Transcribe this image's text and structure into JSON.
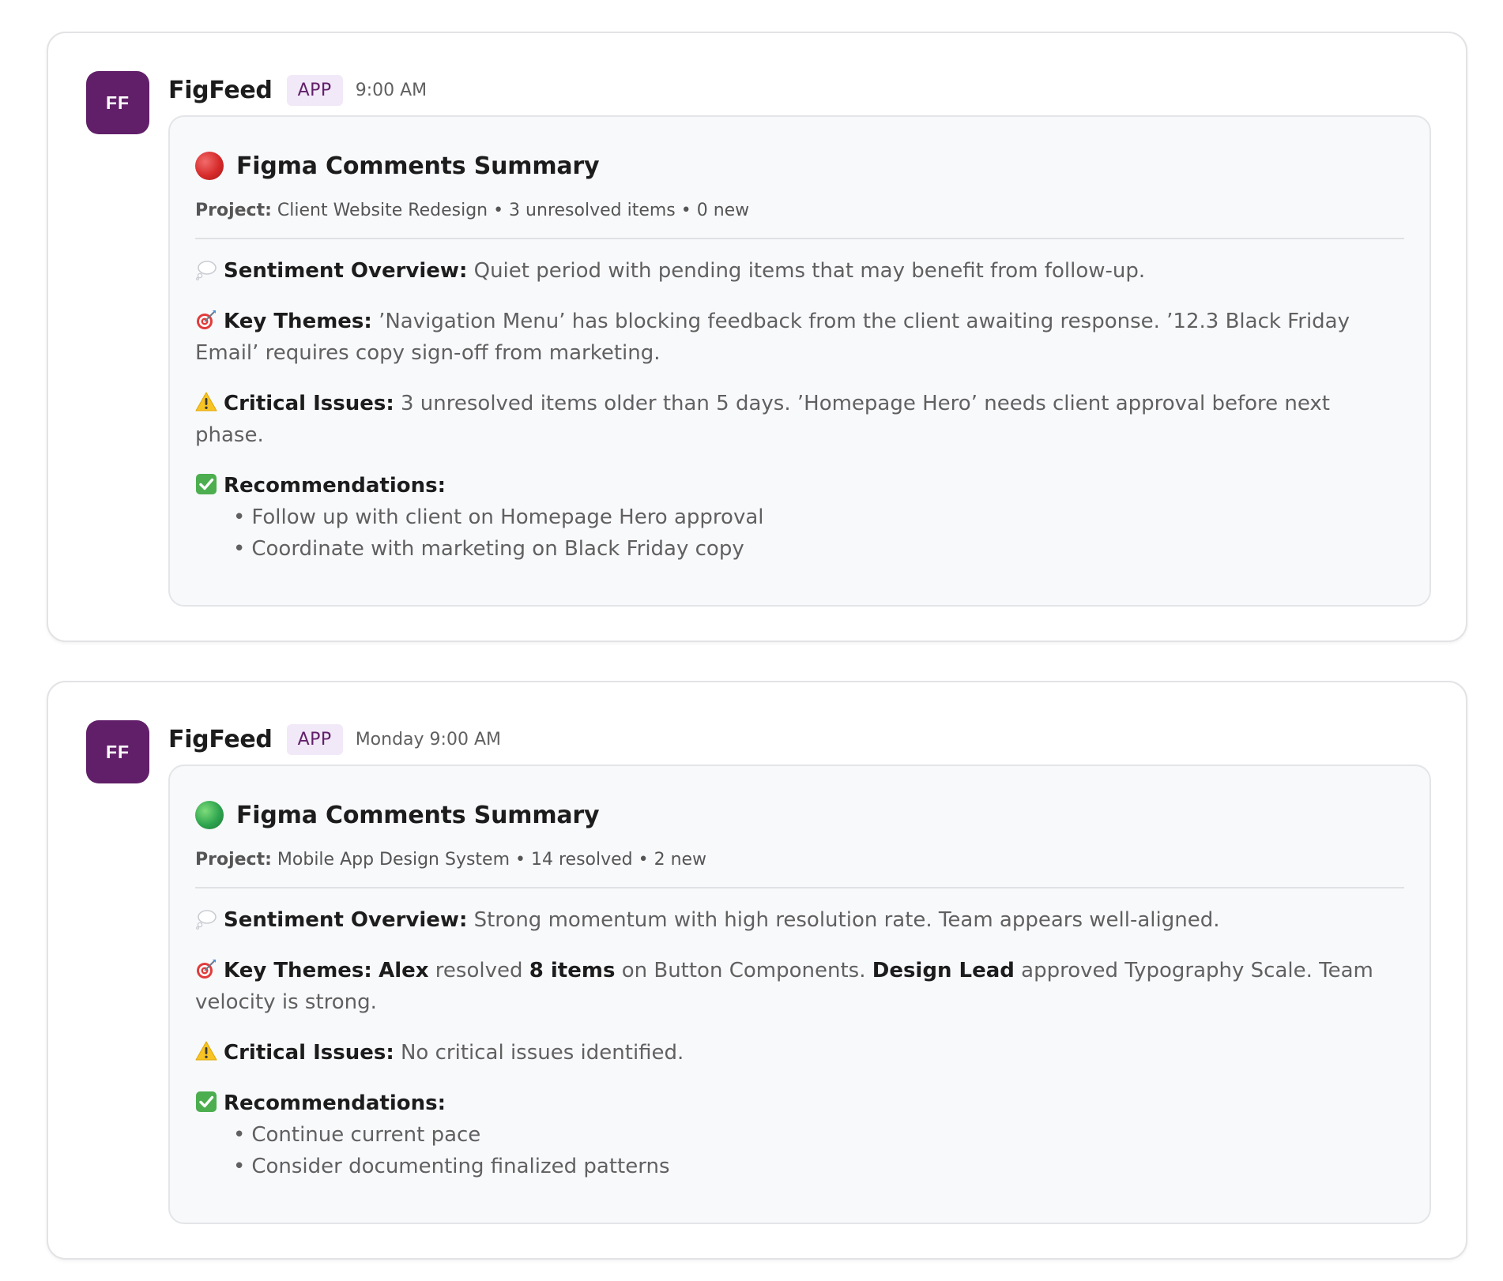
{
  "messages": [
    {
      "avatar_initials": "FF",
      "sender": "FigFeed",
      "badge": "APP",
      "timestamp": "9:00 AM",
      "card": {
        "status_color": "#d62a2a",
        "title": "Figma Comments Summary",
        "meta_label": "Project:",
        "meta_text": "Client Website Redesign • 3 unresolved items • 0 new",
        "sentiment_label": "Sentiment Overview:",
        "sentiment_text": "Quiet period with pending items that may benefit from follow-up.",
        "themes_label": "Key Themes:",
        "themes_text": "’Navigation Menu’ has blocking feedback from the client awaiting response. ’12.3 Black Friday Email’ requires copy sign-off from marketing.",
        "issues_label": "Critical Issues:",
        "issues_text": "3 unresolved items older than 5 days. ’Homepage Hero’ needs client approval before next phase.",
        "recommendations_label": "Recommendations:",
        "recommendations": [
          "Follow up with client on Homepage Hero approval",
          "Coordinate with marketing on Black Friday copy"
        ]
      }
    },
    {
      "avatar_initials": "FF",
      "sender": "FigFeed",
      "badge": "APP",
      "timestamp": "Monday 9:00 AM",
      "card": {
        "status_color": "#2ea44f",
        "title": "Figma Comments Summary",
        "meta_label": "Project:",
        "meta_text": "Mobile App Design System • 14 resolved • 2 new",
        "sentiment_label": "Sentiment Overview:",
        "sentiment_text": "Strong momentum with high resolution rate. Team appears well-aligned.",
        "themes_label": "Key Themes:",
        "themes_parts": {
          "name1": "Alex",
          "text1": "resolved",
          "bold2": "8 items",
          "text2": "on Button Components.",
          "name2": "Design Lead",
          "text3": "approved Typography Scale. Team velocity is strong."
        },
        "issues_label": "Critical Issues:",
        "issues_text": "No critical issues identified.",
        "recommendations_label": "Recommendations:",
        "recommendations": [
          "Continue current pace",
          "Consider documenting finalized patterns"
        ]
      }
    }
  ],
  "icons": {
    "sentiment": "thought-balloon-icon",
    "themes": "target-icon",
    "issues": "warning-icon",
    "recommendations": "check-mark-button-icon"
  },
  "colors": {
    "avatar_bg": "#611f69",
    "badge_bg": "#f1e8f8",
    "badge_text": "#611f69",
    "status_red": "#d62a2a",
    "status_green": "#2ea44f"
  }
}
